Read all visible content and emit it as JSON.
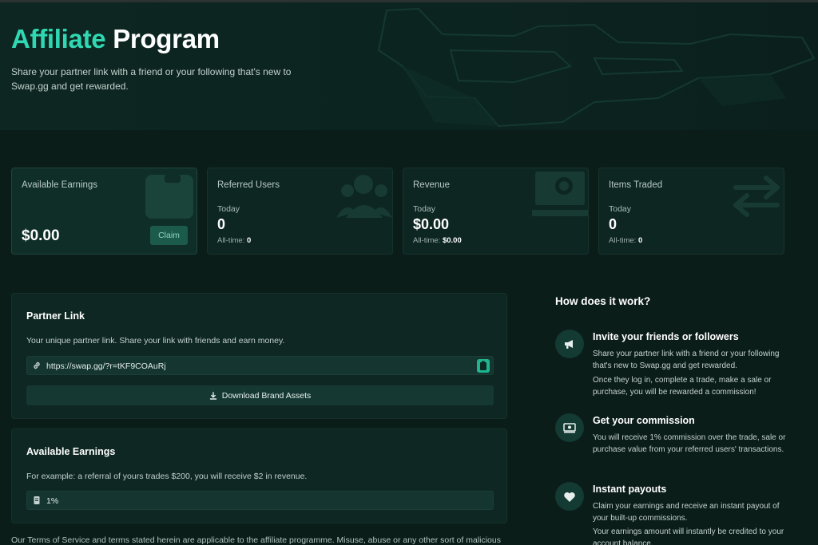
{
  "hero": {
    "title_accent": "Affiliate",
    "title_rest": "Program",
    "subtitle": "Share your partner link with a friend or your following that's new to Swap.gg and get rewarded."
  },
  "stats": {
    "available": {
      "title": "Available Earnings",
      "value": "$0.00",
      "claim_label": "Claim"
    },
    "referred": {
      "title": "Referred Users",
      "period": "Today",
      "value": "0",
      "alltime_label": "All-time:",
      "alltime_value": "0"
    },
    "revenue": {
      "title": "Revenue",
      "period": "Today",
      "value": "$0.00",
      "alltime_label": "All-time:",
      "alltime_value": "$0.00"
    },
    "items": {
      "title": "Items Traded",
      "period": "Today",
      "value": "0",
      "alltime_label": "All-time:",
      "alltime_value": "0"
    }
  },
  "partner_link": {
    "title": "Partner Link",
    "description": "Your unique partner link. Share your link with friends and earn money.",
    "url": "https://swap.gg/?r=tKF9COAuRj",
    "download_label": "Download Brand Assets"
  },
  "earnings_panel": {
    "title": "Available Earnings",
    "description": "For example: a referral of yours trades $200, you will receive $2 in revenue.",
    "rate": "1%"
  },
  "terms": "Our Terms of Service and terms stated herein are applicable to the affiliate programme. Misuse, abuse or any other sort of malicious",
  "how": {
    "title": "How does it work?",
    "steps": [
      {
        "icon": "megaphone-icon",
        "title": "Invite your friends or followers",
        "text1": "Share your partner link with a friend or your following that's new to Swap.gg and get rewarded.",
        "text2": "Once they log in, complete a trade, make a sale or purchase, you will be rewarded a commission!"
      },
      {
        "icon": "money-icon",
        "title": "Get your commission",
        "text1": "You will receive 1% commission over the trade, sale or purchase value from your referred users' transactions."
      },
      {
        "icon": "heart-icon",
        "title": "Instant payouts",
        "text1": "Claim your earnings and receive an instant payout of your built-up commissions.",
        "text2": "Your earnings amount will instantly be credited to your account balance."
      }
    ]
  },
  "colors": {
    "accent": "#2fd8b2",
    "background": "#0b1d19",
    "panel": "#0e2723"
  }
}
